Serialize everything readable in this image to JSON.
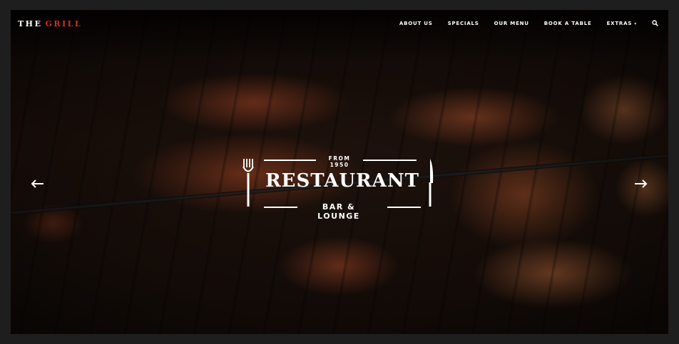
{
  "brand": {
    "name_part1": "THE",
    "name_part2": "GRILL",
    "accent_color": "#d92b1f"
  },
  "nav": {
    "items": [
      {
        "label": "ABOUT US"
      },
      {
        "label": "SPECIALS"
      },
      {
        "label": "OUR MENU"
      },
      {
        "label": "BOOK A TABLE"
      },
      {
        "label": "EXTRAS",
        "has_dropdown": true
      }
    ],
    "search_icon": "search-icon",
    "dropdown_icon": "chevron-down-icon"
  },
  "hero": {
    "tagline": "FROM 1950",
    "title": "RESTAURANT",
    "subtitle": "BAR & LOUNGE",
    "left_icon": "fork-icon",
    "right_icon": "knife-icon"
  },
  "slider": {
    "prev_icon": "arrow-left-icon",
    "next_icon": "arrow-right-icon"
  }
}
